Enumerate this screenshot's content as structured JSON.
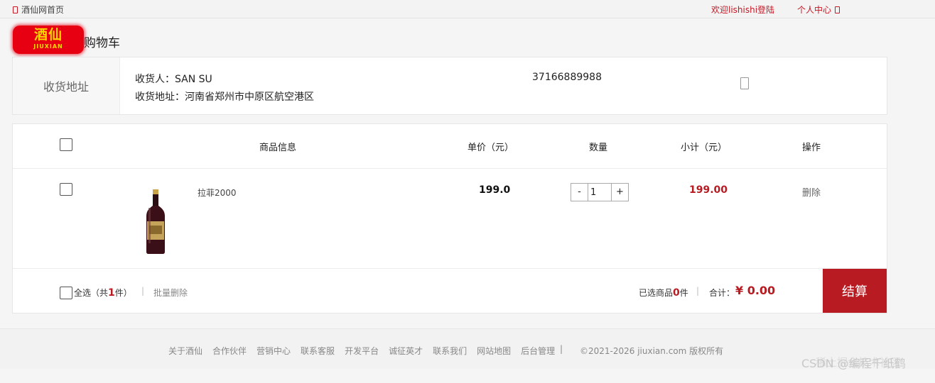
{
  "topbar": {
    "home": "酒仙网首页",
    "welcome": "欢迎lishishi登陆",
    "user_center": "个人中心"
  },
  "logo": {
    "cn": "酒仙",
    "en": "JIUXIAN"
  },
  "page_title": "购物车",
  "address": {
    "label": "收货地址",
    "receiver_label": "收货人：",
    "receiver": "SAN SU",
    "address_label": "收货地址：",
    "full": "河南省郑州市中原区航空港区",
    "phone": "37166889988"
  },
  "cart": {
    "headers": {
      "info": "商品信息",
      "price": "单价（元）",
      "qty": "数量",
      "subtotal": "小计（元）",
      "op": "操作"
    },
    "items": [
      {
        "name": "拉菲2000",
        "price": "199.0",
        "quantity": "1",
        "subtotal": "199.00",
        "delete": "删除",
        "minus": "-",
        "plus": "+"
      }
    ],
    "footer": {
      "select_all": "全选",
      "total_prefix": "（共",
      "item_count": "1",
      "total_suffix": "件）",
      "sep": "|",
      "batch_delete": "批量删除",
      "selected_label": "已选商品",
      "selected_count": "0",
      "selected_unit": "件",
      "sum_label": "合计：",
      "total": "¥ 0.00",
      "checkout": "结算"
    }
  },
  "footer": {
    "links": [
      "关于酒仙",
      "合作伙伴",
      "营销中心",
      "联系客服",
      "开发平台",
      "诚征英才",
      "联系我们",
      "网站地图",
      "后台管理"
    ],
    "pipe": "|",
    "copyright": "©2021-2026 jiuxian.com 版权所有"
  },
  "watermark": {
    "line1": "稀土掘金技术社区",
    "line2": "CSDN @编程千纸鹤"
  },
  "colors": {
    "brand_red": "#b81c22",
    "logo_red": "#e60012",
    "logo_gold": "#ffd700"
  }
}
